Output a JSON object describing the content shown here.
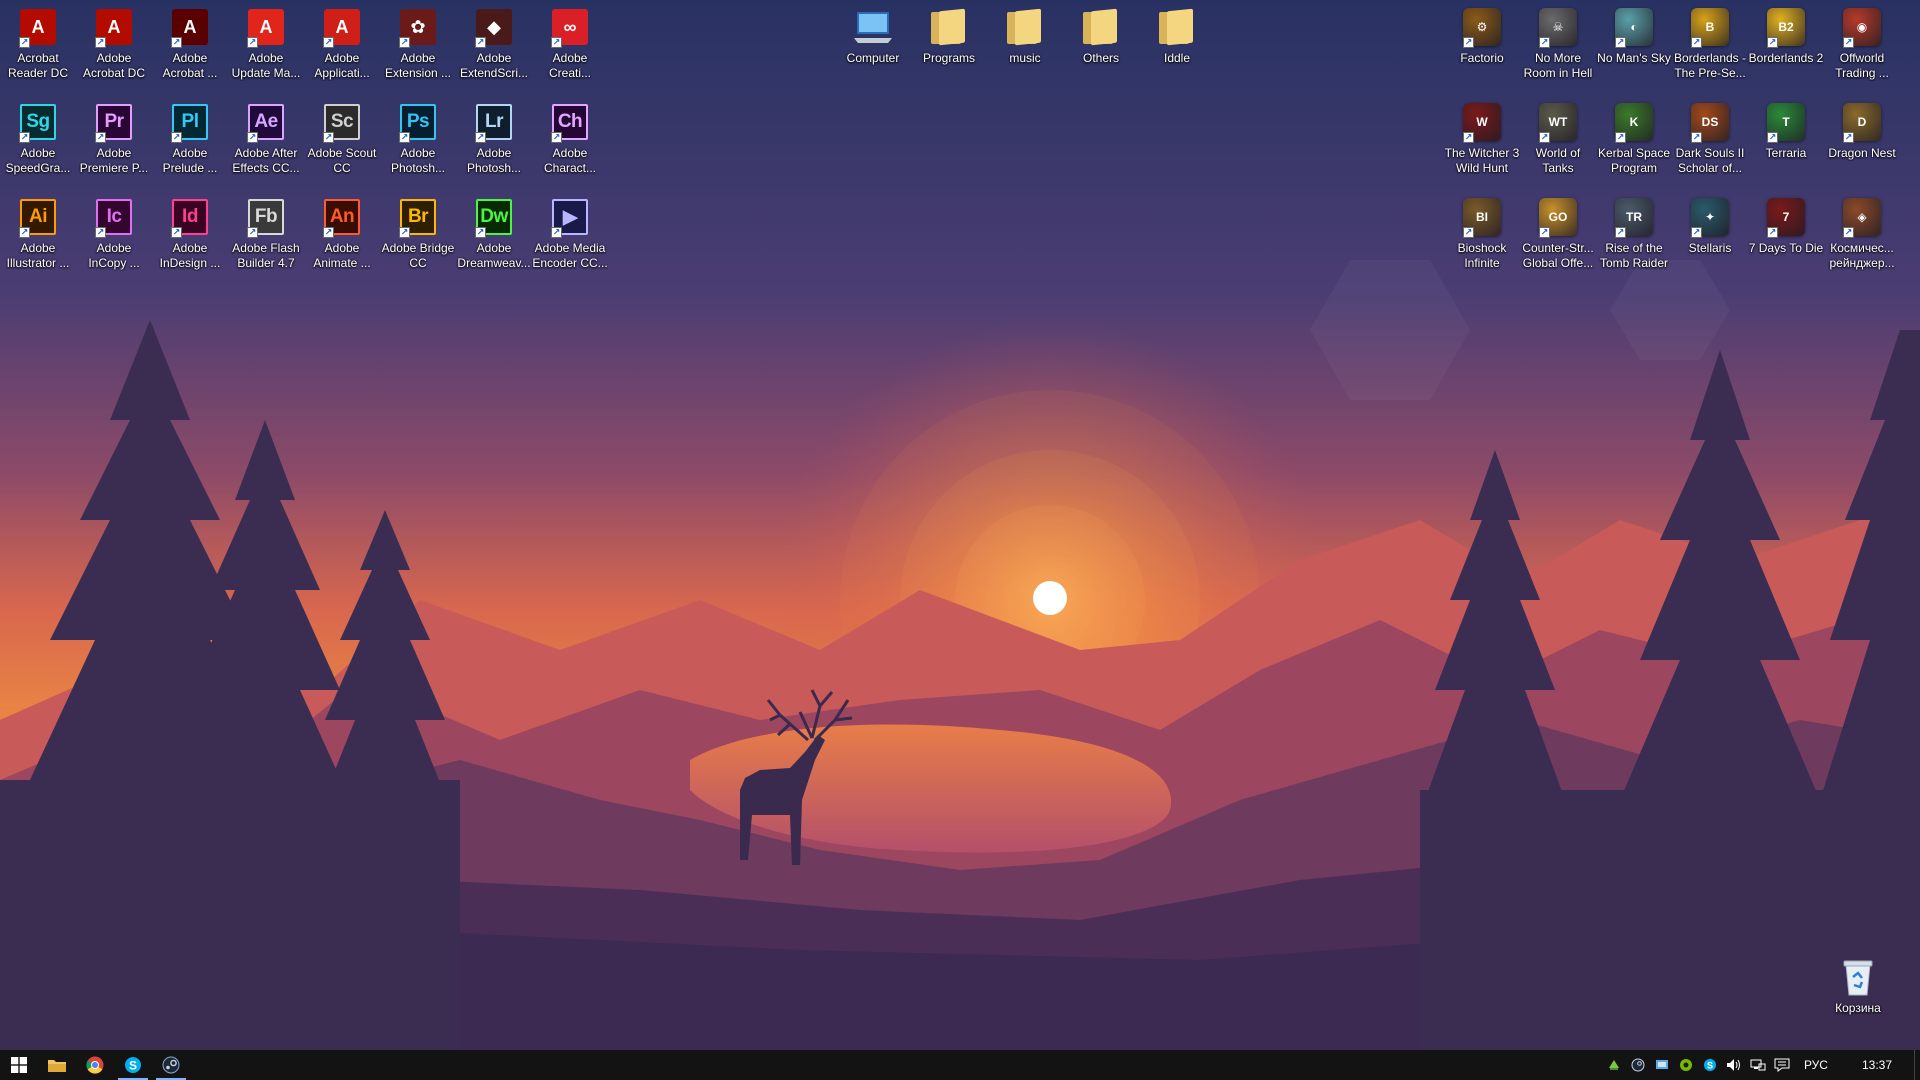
{
  "desktop": {
    "icons_left": [
      {
        "label": "Acrobat Reader DC",
        "type": "red",
        "glyph": "A",
        "color": "#b30b00",
        "col": 0,
        "row": 0
      },
      {
        "label": "Adobe Acrobat DC",
        "type": "red",
        "glyph": "A",
        "color": "#b30b00",
        "col": 1,
        "row": 0
      },
      {
        "label": "Adobe Acrobat ...",
        "type": "red",
        "glyph": "A",
        "color": "#5a0000",
        "col": 2,
        "row": 0
      },
      {
        "label": "Adobe Update Ma...",
        "type": "red",
        "glyph": "A",
        "color": "#e1251b",
        "col": 3,
        "row": 0
      },
      {
        "label": "Adobe Applicati...",
        "type": "red",
        "glyph": "A",
        "color": "#cf1f17",
        "col": 4,
        "row": 0
      },
      {
        "label": "Adobe Extension ...",
        "type": "red",
        "glyph": "✿",
        "color": "#6b1a1a",
        "col": 5,
        "row": 0
      },
      {
        "label": "Adobe ExtendScri...",
        "type": "red",
        "glyph": "◆",
        "color": "#4a1a1a",
        "col": 6,
        "row": 0
      },
      {
        "label": "Adobe Creati...",
        "type": "red",
        "glyph": "∞",
        "color": "#da1f26",
        "col": 7,
        "row": 0
      },
      {
        "label": "Adobe SpeedGra...",
        "type": "adobe",
        "glyph": "Sg",
        "fg": "#31d5e8",
        "bg": "#072b2e",
        "col": 0,
        "row": 1
      },
      {
        "label": "Adobe Premiere P...",
        "type": "adobe",
        "glyph": "Pr",
        "fg": "#e59cff",
        "bg": "#2a0634",
        "col": 1,
        "row": 1
      },
      {
        "label": "Adobe Prelude ...",
        "type": "adobe",
        "glyph": "Pl",
        "fg": "#34c8f5",
        "bg": "#032733",
        "col": 2,
        "row": 1
      },
      {
        "label": "Adobe After Effects CC...",
        "type": "adobe",
        "glyph": "Ae",
        "fg": "#d8a6ff",
        "bg": "#1f0a3b",
        "col": 3,
        "row": 1
      },
      {
        "label": "Adobe Scout CC",
        "type": "adobe",
        "glyph": "Sc",
        "fg": "#cfcfcf",
        "bg": "#2b2b2b",
        "col": 4,
        "row": 1
      },
      {
        "label": "Adobe Photosh...",
        "type": "adobe",
        "glyph": "Ps",
        "fg": "#31c5f0",
        "bg": "#061e30",
        "col": 5,
        "row": 1
      },
      {
        "label": "Adobe Photosh...",
        "type": "adobe",
        "glyph": "Lr",
        "fg": "#b4d6f0",
        "bg": "#0e1e2e",
        "col": 6,
        "row": 1
      },
      {
        "label": "Adobe Charact...",
        "type": "adobe",
        "glyph": "Ch",
        "fg": "#e3a6ff",
        "bg": "#250737",
        "col": 7,
        "row": 1
      },
      {
        "label": "Adobe Illustrator ...",
        "type": "adobe",
        "glyph": "Ai",
        "fg": "#ff9a00",
        "bg": "#331900",
        "col": 0,
        "row": 2
      },
      {
        "label": "Adobe InCopy ...",
        "type": "adobe",
        "glyph": "Ic",
        "fg": "#e36cf3",
        "bg": "#33062f",
        "col": 1,
        "row": 2
      },
      {
        "label": "Adobe InDesign ...",
        "type": "adobe",
        "glyph": "Id",
        "fg": "#ff3f94",
        "bg": "#3a0321",
        "col": 2,
        "row": 2
      },
      {
        "label": "Adobe Flash Builder 4.7",
        "type": "adobe",
        "glyph": "Fb",
        "fg": "#d8d8d8",
        "bg": "#3a3a3a",
        "col": 3,
        "row": 2
      },
      {
        "label": "Adobe Animate ...",
        "type": "adobe",
        "glyph": "An",
        "fg": "#ff5a29",
        "bg": "#3a0d03",
        "col": 4,
        "row": 2
      },
      {
        "label": "Adobe Bridge CC",
        "type": "adobe",
        "glyph": "Br",
        "fg": "#ffb700",
        "bg": "#2e1f00",
        "col": 5,
        "row": 2
      },
      {
        "label": "Adobe Dreamweav...",
        "type": "adobe",
        "glyph": "Dw",
        "fg": "#4cf542",
        "bg": "#072a05",
        "col": 6,
        "row": 2
      },
      {
        "label": "Adobe Media Encoder CC...",
        "type": "adobe",
        "glyph": "▶",
        "fg": "#b7b6ff",
        "bg": "#1a1a4a",
        "col": 7,
        "row": 2
      }
    ],
    "icons_center": [
      {
        "label": "Computer",
        "type": "computer"
      },
      {
        "label": "Programs",
        "type": "folder"
      },
      {
        "label": "music",
        "type": "folder"
      },
      {
        "label": "Others",
        "type": "folder"
      },
      {
        "label": "Iddle",
        "type": "folder"
      }
    ],
    "icons_right": [
      {
        "label": "Factorio",
        "color": "#8a5a1a",
        "glyph": "⚙",
        "col": 0,
        "row": 0
      },
      {
        "label": "No More Room in Hell",
        "color": "#6a6a6a",
        "glyph": "☠",
        "col": 1,
        "row": 0
      },
      {
        "label": "No Man's Sky",
        "color": "#5aa0a8",
        "glyph": "◐",
        "col": 2,
        "row": 0
      },
      {
        "label": "Borderlands - The Pre-Se...",
        "color": "#d6a21a",
        "glyph": "B",
        "col": 3,
        "row": 0
      },
      {
        "label": "Borderlands 2",
        "color": "#e0b020",
        "glyph": "B2",
        "col": 4,
        "row": 0
      },
      {
        "label": "Offworld Trading ...",
        "color": "#b53a2a",
        "glyph": "◉",
        "col": 5,
        "row": 0
      },
      {
        "label": "The Witcher 3 Wild Hunt",
        "color": "#7a1a1a",
        "glyph": "W",
        "col": 0,
        "row": 1
      },
      {
        "label": "World of Tanks",
        "color": "#5a5a4a",
        "glyph": "WT",
        "col": 1,
        "row": 1
      },
      {
        "label": "Kerbal Space Program",
        "color": "#3a7a2a",
        "glyph": "K",
        "col": 2,
        "row": 1
      },
      {
        "label": "Dark Souls II Scholar of...",
        "color": "#a04a1a",
        "glyph": "DS",
        "col": 3,
        "row": 1
      },
      {
        "label": "Terraria",
        "color": "#2a8a3a",
        "glyph": "T",
        "col": 4,
        "row": 1
      },
      {
        "label": "Dragon Nest",
        "color": "#8a6a2a",
        "glyph": "D",
        "col": 5,
        "row": 1
      },
      {
        "label": "Bioshock Infinite",
        "color": "#7a5a2a",
        "glyph": "BI",
        "col": 0,
        "row": 2
      },
      {
        "label": "Counter-Str... Global Offe...",
        "color": "#c6902a",
        "glyph": "GO",
        "col": 1,
        "row": 2
      },
      {
        "label": "Rise of the Tomb Raider",
        "color": "#4a5a6a",
        "glyph": "TR",
        "col": 2,
        "row": 2
      },
      {
        "label": "Stellaris",
        "color": "#2a5a6a",
        "glyph": "✦",
        "col": 3,
        "row": 2
      },
      {
        "label": "7 Days To Die",
        "color": "#7a1a1a",
        "glyph": "7",
        "col": 4,
        "row": 2
      },
      {
        "label": "Космичес... рейнджер...",
        "color": "#8a4a2a",
        "glyph": "◈",
        "col": 5,
        "row": 2
      }
    ],
    "recycle_bin": {
      "label": "Корзина"
    }
  },
  "taskbar": {
    "buttons": [
      {
        "name": "start-button",
        "icon": "windows-icon",
        "active": false
      },
      {
        "name": "file-explorer-button",
        "icon": "folder-icon",
        "active": false
      },
      {
        "name": "chrome-button",
        "icon": "chrome-icon",
        "active": false
      },
      {
        "name": "skype-button",
        "icon": "skype-icon",
        "active": true
      },
      {
        "name": "steam-button",
        "icon": "steam-icon",
        "active": true
      }
    ],
    "tray": {
      "language": "РУС",
      "time": "13:37"
    }
  },
  "colors": {
    "taskbar_bg": "#131313",
    "sky_top": "#2c3463",
    "sky_mid": "#8a4a6a",
    "sun_glow": "#f1883a"
  }
}
